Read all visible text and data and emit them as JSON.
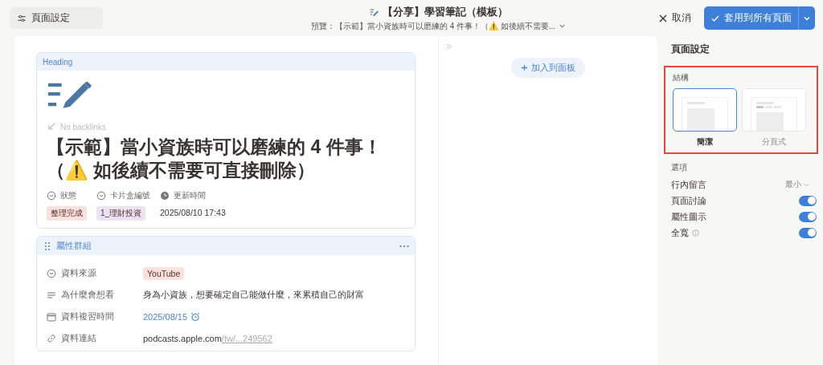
{
  "toolbar": {
    "settings_button": "頁面設定",
    "title": "【分享】學習筆記（模板）",
    "preview_label": "預覽：",
    "preview_text": "【示範】當小資族時可以磨練的 4 件事！（⚠️ 如後續不需要...",
    "cancel": "取消",
    "apply": "套用到所有頁面"
  },
  "heading_block": {
    "label": "Heading",
    "backlinks": "No backlinks",
    "title_lines": [
      "【示範】當小資族時可以磨練的 4 件事！",
      "（⚠️ 如後續不需要可直接刪除）"
    ],
    "properties": [
      {
        "name": "狀態",
        "kind": "tag",
        "value": "整理完成",
        "color": "#f9e1de"
      },
      {
        "name": "卡片盒編號",
        "kind": "tag",
        "value": "1_理財投資",
        "color": "#ebe3f3"
      },
      {
        "name": "更新時間",
        "kind": "text",
        "value": "2025/08/10 17:43"
      }
    ]
  },
  "property_group": {
    "title": "屬性群組",
    "rows": [
      {
        "name": "資料來源",
        "kind": "tag",
        "value": "YouTube",
        "color": "#f9e1de"
      },
      {
        "name": "為什麼會想看",
        "kind": "text",
        "value": "身為小資族，想要確定自己能做什麼，來累積自己的財富"
      },
      {
        "name": "資料複習時間",
        "kind": "date",
        "value": "2025/08/15"
      },
      {
        "name": "資料連結",
        "kind": "url",
        "value": "podcasts.apple.com",
        "value_dim": "/tw/...249562"
      }
    ]
  },
  "side_canvas": {
    "add_button": "加入到面板"
  },
  "settings_panel": {
    "title": "頁面設定",
    "structure": {
      "label": "結構",
      "highlighted": true,
      "layouts": [
        {
          "kind": "simple",
          "label": "簡潔",
          "selected": true
        },
        {
          "kind": "tabbed",
          "label": "分頁式",
          "selected": false
        }
      ]
    },
    "options_label": "選項",
    "options": [
      {
        "kind": "dropdown",
        "label": "行內留言",
        "value": "最小"
      },
      {
        "kind": "toggle",
        "label": "頁面討論",
        "on": true
      },
      {
        "kind": "toggle",
        "label": "屬性圖示",
        "on": true
      },
      {
        "kind": "toggle",
        "label": "全寬",
        "on": true,
        "info": true
      }
    ]
  }
}
